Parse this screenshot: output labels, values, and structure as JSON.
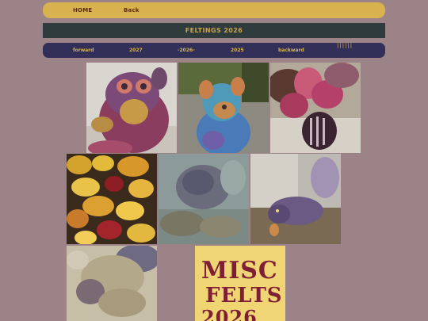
{
  "top_nav": {
    "home": "HOME",
    "back": "Back"
  },
  "title": "FELTINGS 2026",
  "sub_nav": {
    "forward": "forward",
    "y2027": "2027",
    "y2026": "-2026-",
    "y2025": "2025",
    "backward": "backward",
    "ticks": "||||||"
  },
  "tiles": [
    "felted-dragon-purple",
    "felted-blue-animal",
    "felted-pink-flower-creature",
    "felted-yellow-bits",
    "felted-grey-blur",
    "felted-purple-bird",
    "felted-fuzzy-creature"
  ],
  "misc": {
    "line1": "MISC",
    "line2": "FELTS",
    "line3": "2026"
  },
  "colors": {
    "background": "#9b8387",
    "nav_gold": "#d7b24e",
    "title_dark": "#2f3b3c",
    "subnav_navy": "#323058"
  }
}
